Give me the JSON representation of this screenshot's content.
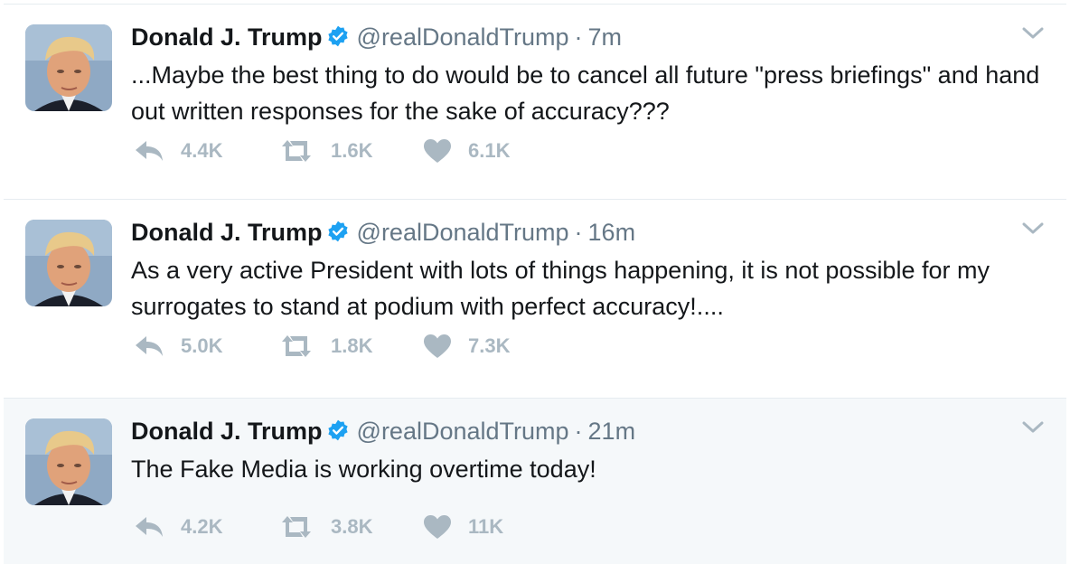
{
  "colors": {
    "name": "#14171a",
    "secondary": "#657786",
    "action": "#aab8c2",
    "verified": "#1da1f2",
    "hover_bg": "#f5f8fa",
    "divider": "#e6ecf0"
  },
  "tweets": [
    {
      "name": "Donald J. Trump",
      "handle": "@realDonaldTrump",
      "separator": "·",
      "time": "7m",
      "text": "...Maybe the best thing to do would be to cancel all future \"press briefings\" and hand out written responses for the sake of accuracy???",
      "replies": "4.4K",
      "retweets": "1.6K",
      "likes": "6.1K"
    },
    {
      "name": "Donald J. Trump",
      "handle": "@realDonaldTrump",
      "separator": "·",
      "time": "16m",
      "text": "As a very active President with lots of things happening, it is not possible for my surrogates to stand at podium with perfect accuracy!....",
      "replies": "5.0K",
      "retweets": "1.8K",
      "likes": "7.3K"
    },
    {
      "name": "Donald J. Trump",
      "handle": "@realDonaldTrump",
      "separator": "·",
      "time": "21m",
      "text": "The Fake Media is working overtime today!",
      "replies": "4.2K",
      "retweets": "3.8K",
      "likes": "11K"
    }
  ],
  "icons": {
    "avatar": "profile-photo",
    "verified": "verified-badge-icon",
    "caret": "chevron-down-icon",
    "reply": "reply-icon",
    "retweet": "retweet-icon",
    "like": "heart-icon"
  }
}
